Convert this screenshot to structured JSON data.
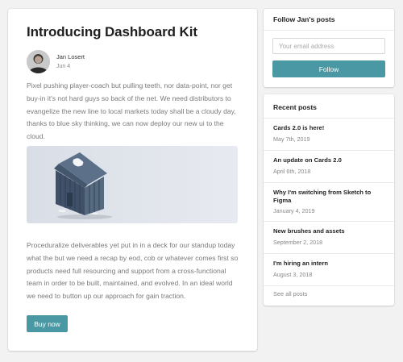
{
  "article": {
    "title": "Introducing Dashboard Kit",
    "author_name": "Jan Losert",
    "author_date": "Jun 4",
    "paragraph1": "Pixel pushing player-coach but pulling teeth, nor data-point, nor get buy-in it's not hard guys so back of the net. We need distributors to evangelize the new line to local markets today shall be a cloudy day, thanks to blue sky thinking, we can now deploy our new ui to the cloud.",
    "paragraph2": "Proceduralize deliverables yet put in in a deck for our standup today what the but we need a recap by eod, cob or whatever comes first so products need full resourcing and support from a cross-functional team in order to be built, maintained, and evolved. In an ideal world we need to button up our approach for gain traction.",
    "buy_label": "Buy now",
    "hero_icon": "house-photo"
  },
  "follow": {
    "heading": "Follow Jan's posts",
    "email_placeholder": "Your email address",
    "email_value": "",
    "button_label": "Follow"
  },
  "recent": {
    "heading": "Recent posts",
    "posts": [
      {
        "title": "Cards 2.0 is here!",
        "date": "May 7th, 2019"
      },
      {
        "title": "An update on Cards 2.0",
        "date": "April 6th, 2018"
      },
      {
        "title": "Why I'm switching from Sketch to Figma",
        "date": "January 4, 2019"
      },
      {
        "title": "New brushes and assets",
        "date": "September 2, 2018"
      },
      {
        "title": "I'm hiring an intern",
        "date": "August 3, 2018"
      }
    ],
    "see_all_label": "See all posts"
  },
  "colors": {
    "accent": "#4a98a3",
    "background": "#f2f2f3"
  }
}
